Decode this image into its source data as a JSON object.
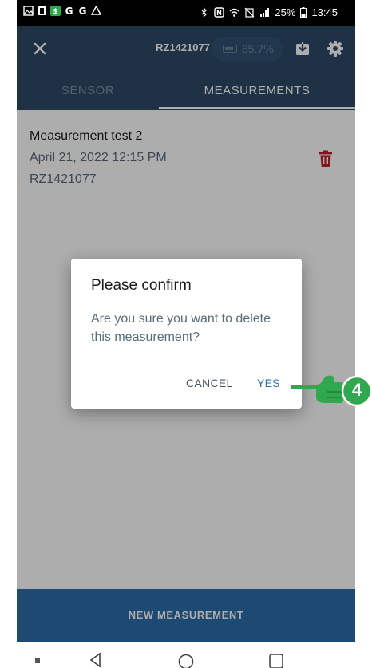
{
  "status_bar": {
    "battery_percent": "25%",
    "time": "13:45"
  },
  "app_bar": {
    "title": "RZ1421077",
    "battery_level": "85.7%",
    "close_icon": "close-icon",
    "download_icon": "download-icon",
    "settings_icon": "gear-icon"
  },
  "tabs": [
    {
      "label": "SENSOR",
      "active": false
    },
    {
      "label": "MEASUREMENTS",
      "active": true
    }
  ],
  "measurements": [
    {
      "title": "Measurement test 2",
      "date": "April 21, 2022 12:15 PM",
      "serial": "RZ1421077"
    }
  ],
  "new_measurement_label": "NEW MEASUREMENT",
  "dialog": {
    "title": "Please confirm",
    "message": "Are you sure you want to delete this measurement?",
    "cancel_label": "CANCEL",
    "confirm_label": "YES"
  },
  "annotation": {
    "step_number": "4"
  },
  "colors": {
    "app_bar": "#2e4a66",
    "primary": "#2c6ea8",
    "delete": "#c0202a",
    "pointer_green": "#2fa84f"
  }
}
